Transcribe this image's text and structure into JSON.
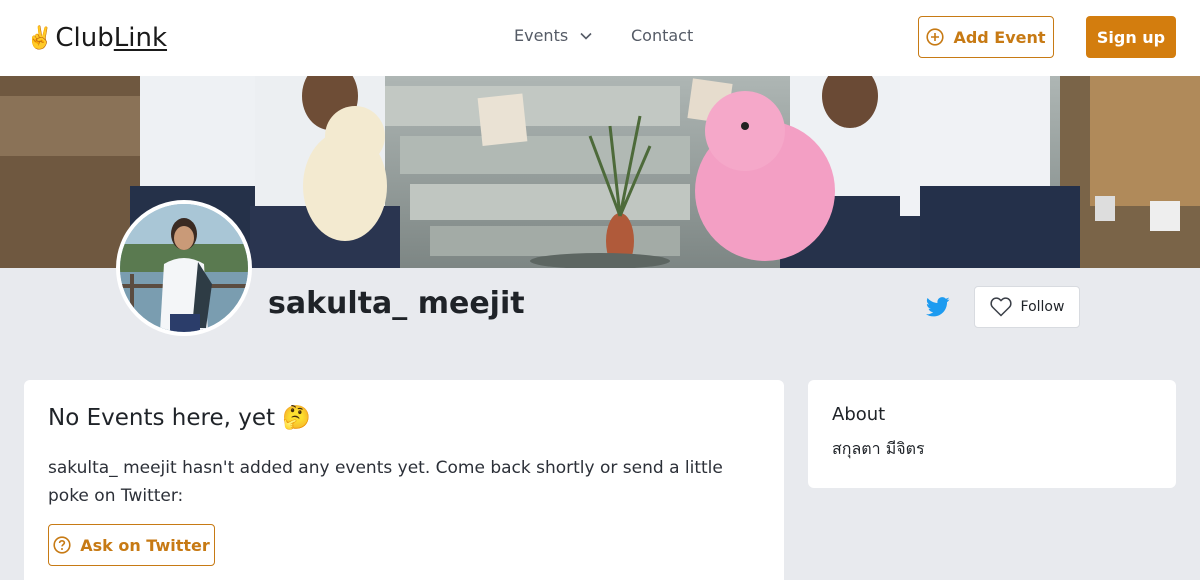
{
  "header": {
    "logo_prefix": "Club",
    "logo_suffix": "Link",
    "logo_icon": "victory-hand-icon",
    "nav": {
      "events_label": "Events",
      "contact_label": "Contact"
    },
    "add_event_label": "Add Event",
    "signup_label": "Sign up"
  },
  "profile": {
    "name": "sakulta_ meejit",
    "follow_label": "Follow"
  },
  "events_card": {
    "title": "No Events here, yet",
    "title_emoji": "🤔",
    "message": "sakulta_ meejit hasn't added any events yet. Come back shortly or send a little poke on Twitter:",
    "ask_label": "Ask on Twitter"
  },
  "about": {
    "title": "About",
    "text": "สกุลตา มีจิตร"
  },
  "colors": {
    "accent": "#d37d0e",
    "accent_outline": "#c77a14",
    "twitter": "#1d9bf0",
    "page_bg": "#e8eaee"
  }
}
